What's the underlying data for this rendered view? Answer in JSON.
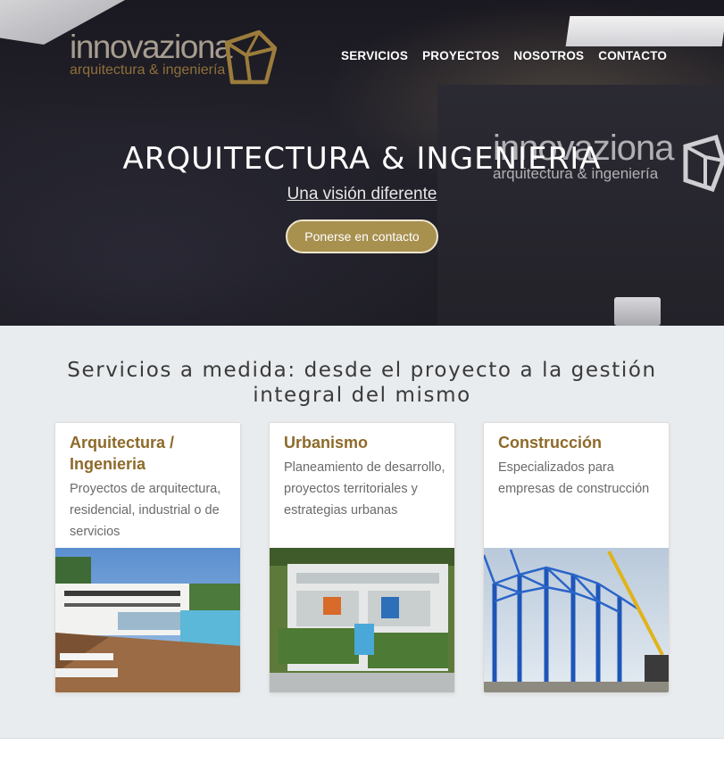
{
  "header": {
    "logo": {
      "word": "innovaziona",
      "tagline": "arquitectura & ingeniería"
    },
    "nav": [
      "SERVICIOS",
      "PROYECTOS",
      "NOSOTROS",
      "CONTACTO"
    ]
  },
  "hero": {
    "title": "ARQUITECTURA & INGENIERIA",
    "subtitle": "Una visión diferente",
    "cta": "Ponerse en contacto",
    "wall_brand": {
      "word": "innovaziona",
      "tagline": "arquitectura & ingeniería"
    }
  },
  "services": {
    "heading_line1": "Servicios a medida: desde el proyecto a la gestión",
    "heading_line2": "integral del mismo",
    "cards": [
      {
        "title": "Arquitectura / Ingenieria",
        "desc": "Proyectos de arquitectura, residencial, industrial o de servicios"
      },
      {
        "title": "Urbanismo",
        "desc": "Planeamiento de desarrollo, proyectos territoriales y estrategias urbanas"
      },
      {
        "title": "Construcción",
        "desc": "Especializados para empresas de construcción"
      }
    ]
  },
  "colors": {
    "accent": "#a8904f",
    "card_title": "#8d6a2a",
    "section_bg": "#e9ecee"
  }
}
